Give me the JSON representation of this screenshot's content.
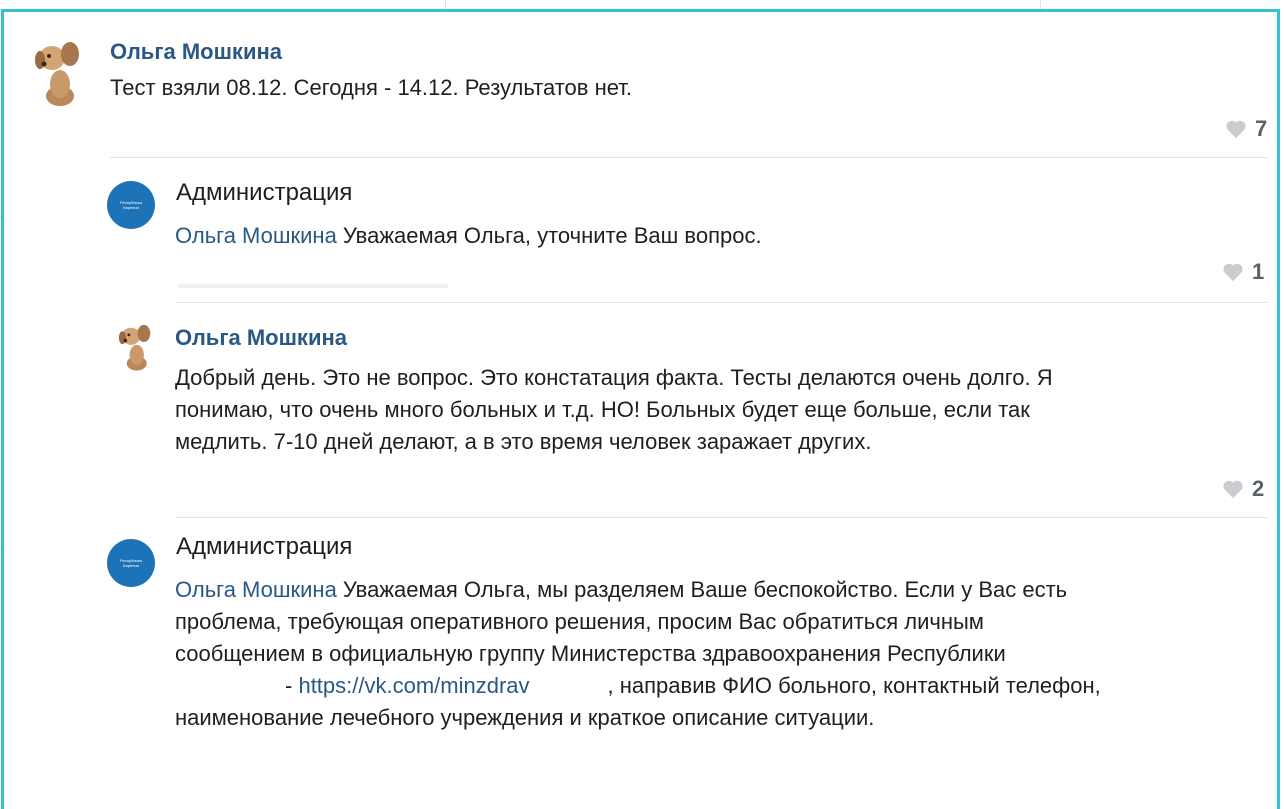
{
  "comments": [
    {
      "author": "Ольга Мошкина",
      "text": "Тест взяли 08.12. Сегодня - 14.12. Результатов нет.",
      "likes": "7",
      "avatar_icon": "puppy-avatar-icon"
    },
    {
      "author": "Администрация",
      "mention": "Ольга Мошкина",
      "text": " Уважаемая Ольга, уточните Ваш вопрос.",
      "likes": "1",
      "avatar_icon": "admin-logo-icon"
    },
    {
      "author": "Ольга Мошкина",
      "lines": [
        "Добрый день. Это не вопрос. Это констатация факта. Тесты делаются очень долго. Я",
        "понимаю, что очень много больных и т.д. НО! Больных будет еще больше, если так",
        "медлить. 7-10 дней делают, а в это время человек заражает других."
      ],
      "likes": "2",
      "avatar_icon": "puppy-avatar-icon"
    },
    {
      "author": "Администрация",
      "mention": "Ольга Мошкина",
      "line1_rest": " Уважаемая Ольга, мы разделяем Ваше беспокойство. Если у Вас есть",
      "line2": "проблема, требующая оперативного решения, просим Вас обратиться личным",
      "line3": "сообщением в официальную группу Министерства здравоохранения Республики",
      "line4_prefix": "- ",
      "link": "https://vk.com/minzdrav",
      "line4_suffix": ", направив ФИО больного, контактный телефон,",
      "line5": "наименование лечебного учреждения и краткое описание ситуации.",
      "avatar_icon": "admin-logo-icon"
    }
  ],
  "colors": {
    "frame": "#35c2cf",
    "author_link": "#2a5885",
    "admin_avatar": "#1d73b8"
  },
  "like_icon": "heart-icon"
}
